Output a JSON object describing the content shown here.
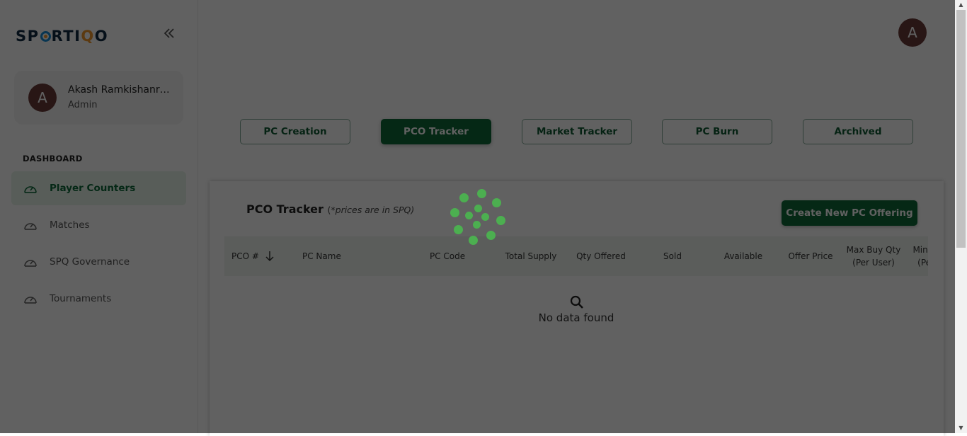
{
  "brand": {
    "logo_prefix": "SP",
    "logo_mid": "RTI",
    "logo_accent": "Q",
    "logo_suffix": "O",
    "collapse_icon": "double-chevron-left"
  },
  "user": {
    "initial": "A",
    "name": "Akash Ramkishanra...",
    "role": "Admin"
  },
  "sidebar": {
    "section_label": "DASHBOARD",
    "items": [
      {
        "label": "Player Counters",
        "icon": "gauge-icon",
        "active": true
      },
      {
        "label": "Matches",
        "icon": "gauge-icon",
        "active": false
      },
      {
        "label": "SPQ Governance",
        "icon": "gauge-icon",
        "active": false
      },
      {
        "label": "Tournaments",
        "icon": "gauge-icon",
        "active": false
      }
    ]
  },
  "header": {
    "avatar_initial": "A"
  },
  "tabs": [
    {
      "label": "PC Creation",
      "active": false
    },
    {
      "label": "PCO Tracker",
      "active": true
    },
    {
      "label": "Market Tracker",
      "active": false
    },
    {
      "label": "PC Burn",
      "active": false
    },
    {
      "label": "Archived",
      "active": false
    }
  ],
  "card": {
    "title": "PCO Tracker",
    "subtitle_open": "(",
    "subtitle": "*prices are in SPQ)",
    "create_button": "Create New PC Offering"
  },
  "table": {
    "columns": [
      {
        "label": "PCO #",
        "sortable": true
      },
      {
        "label": "PC Name"
      },
      {
        "label": "PC Code"
      },
      {
        "label": "Total Supply"
      },
      {
        "label": "Qty Offered"
      },
      {
        "label": "Sold"
      },
      {
        "label": "Available"
      },
      {
        "label": "Offer Price"
      },
      {
        "label": "Max Buy Qty (Per User)"
      },
      {
        "label": "Min Buy Qty (Per User)"
      }
    ],
    "empty_text": "No data found",
    "empty_icon": "search-icon"
  },
  "loading": {
    "visible": true,
    "spinner": "dotted-loader",
    "color": "#4caf50"
  },
  "colors": {
    "primary": "#0e6b38",
    "active_bg": "#e6f4ea",
    "avatar": "#6b3a37"
  }
}
